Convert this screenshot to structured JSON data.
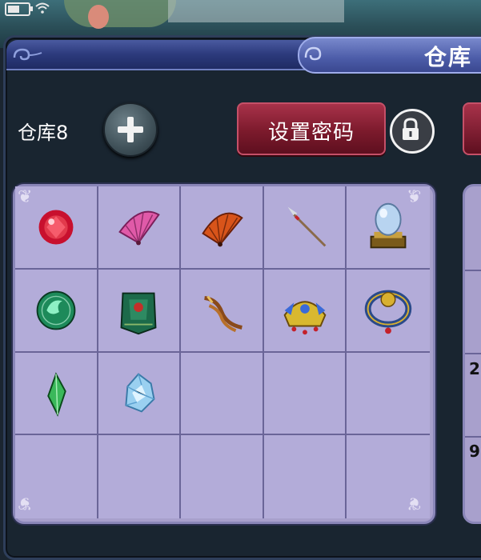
{
  "status_bar": {
    "battery_icon": "battery-icon",
    "wifi_icon": "wifi-icon",
    "battery_level": 0.6
  },
  "window": {
    "title": "仓库"
  },
  "warehouse": {
    "label": "仓库8",
    "add_icon": "plus-icon",
    "set_password_label": "设置密码",
    "lock_icon": "lock-icon"
  },
  "grid": {
    "rows": 4,
    "cols": 5,
    "items": [
      "red-gem-icon",
      "pink-fan-icon",
      "orange-fan-icon",
      "spear-icon",
      "crystal-ball-icon",
      "jade-orb-icon",
      "green-armor-icon",
      "twin-blades-icon",
      "gold-headdress-icon",
      "dragon-ring-icon",
      "green-crystal-icon",
      "ice-crystal-icon",
      "",
      "",
      "",
      "",
      "",
      "",
      "",
      ""
    ]
  },
  "right_panel": {
    "partial_numbers": [
      "2",
      "9"
    ]
  },
  "colors": {
    "panel_bg": "#192530",
    "header_blue": "#2c3a7c",
    "button_red": "#7c1a2c",
    "grid_cell": "#b3acd9",
    "grid_line": "#6a6598"
  }
}
